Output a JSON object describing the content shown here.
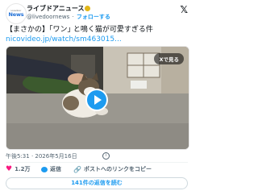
{
  "header": {
    "avatar_small_text": "Livedoor",
    "avatar_brand": "News",
    "display_name": "ライブドアニュース",
    "handle": "@livedoornews",
    "separator": "·",
    "follow_label": "フォローする",
    "x_logo": "𝕏"
  },
  "post": {
    "text": "【まさかの】｢ワン｣ と鳴く猫が可愛すぎる件",
    "link": "nicovideo.jp/watch/sm463015..."
  },
  "media": {
    "badge": "Xで見る"
  },
  "meta": {
    "timestamp": "午後5:31 · 2026年5月16日",
    "info_icon": "i"
  },
  "actions": {
    "like_count": "1.2万",
    "reply_label": "返信",
    "copy_link_label": "ポストへのリンクをコピー"
  },
  "replies_button": "141件の返信を読む",
  "colors": {
    "accent": "#1d9bf0",
    "like": "#f91880",
    "verified": "#e2b719"
  }
}
